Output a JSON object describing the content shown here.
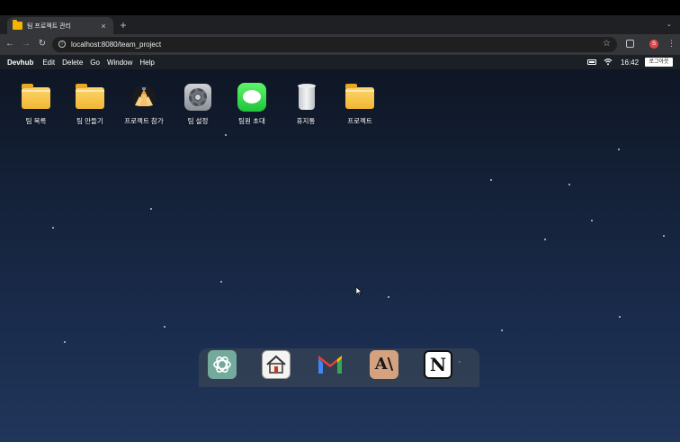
{
  "browser": {
    "tab_title": "팀 프로젝트 관리",
    "tab_close": "×",
    "new_tab": "+",
    "tab_menu": "⌄",
    "back": "←",
    "forward": "→",
    "reload": "↻",
    "url": "localhost:8080/team_project",
    "bookmark_star": "☆",
    "profile_initial": "S",
    "menu_dots": "⋮"
  },
  "menubar": {
    "brand": "Devhub",
    "items": [
      "Edit",
      "Delete",
      "Go",
      "Window",
      "Help"
    ],
    "clock": "16:42",
    "logout_label": "로그아웃"
  },
  "desktop": {
    "icons": [
      {
        "label": "팀 목록",
        "icon": "folder-icon"
      },
      {
        "label": "팀 만들기",
        "icon": "folder-icon"
      },
      {
        "label": "프로젝트 참가",
        "icon": "team-hands-icon"
      },
      {
        "label": "팀 설정",
        "icon": "gear-icon"
      },
      {
        "label": "팀원 초대",
        "icon": "messages-icon"
      },
      {
        "label": "휴지통",
        "icon": "trash-icon"
      },
      {
        "label": "프로젝트",
        "icon": "folder-icon"
      }
    ]
  },
  "dock": {
    "apps": [
      "chatgpt-icon",
      "home-icon",
      "gmail-icon",
      "anthropic-icon",
      "notion-icon"
    ],
    "anthropic_label": "A\\",
    "notion_label": "N"
  },
  "colors": {
    "folder": "#f2b634",
    "messages": "#1fc33a",
    "chatgpt": "#74aa9c",
    "anthropic": "#d4a27f",
    "profile": "#e0464b"
  }
}
